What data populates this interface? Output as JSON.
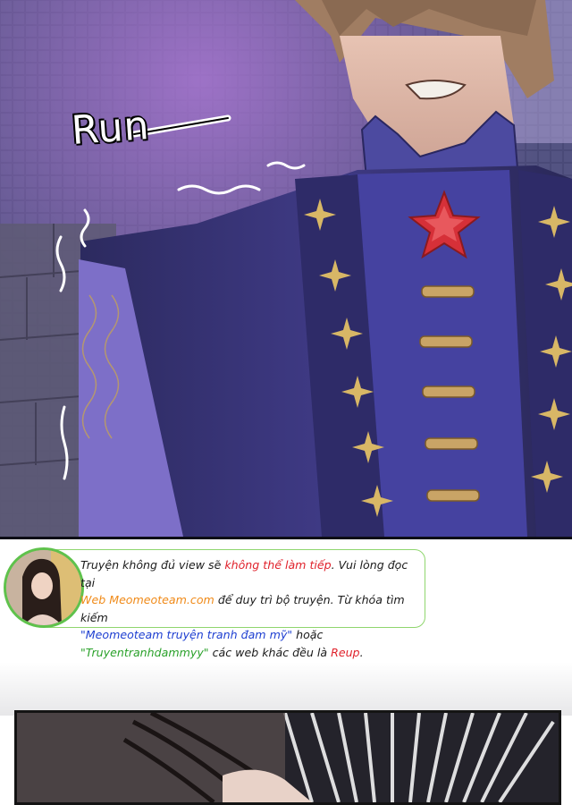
{
  "panel_top": {
    "sfx_text": "Run"
  },
  "credit": {
    "line1_a": "Truyện không đủ view sẽ ",
    "line1_b": "không thể làm tiếp",
    "line1_c": ". Vui lòng đọc tại",
    "line2_a": "Web Meomeoteam.com",
    "line2_b": " để duy trì bộ truyện. Từ khóa tìm kiếm",
    "line3_a": "\"Meomeoteam truyện tranh đam mỹ\"",
    "line3_b": " hoặc",
    "line4_a": "\"Truyentranhdammyy\"",
    "line4_b": " các web khác đều là ",
    "line4_c": "Reup",
    "line4_d": "."
  },
  "colors": {
    "coat": "#3a3577",
    "star": "#d8b766",
    "brooch": "#d63038",
    "border_green": "#8fd66e"
  }
}
